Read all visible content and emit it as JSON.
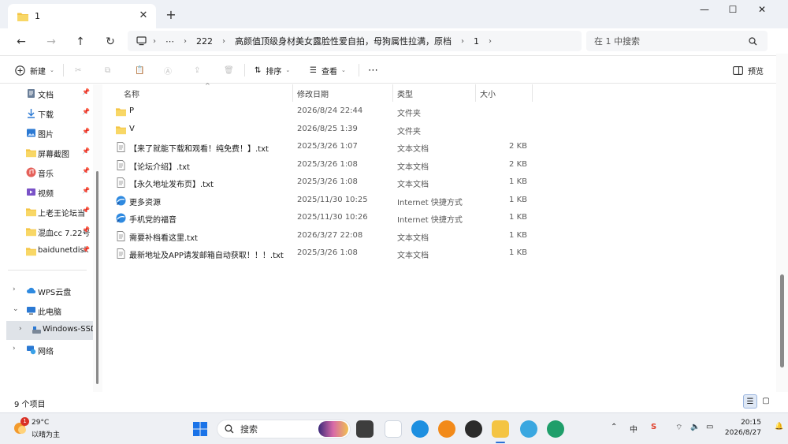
{
  "tab": {
    "title": "1",
    "close": "✕",
    "new": "+"
  },
  "window_controls": {
    "minimize": "—",
    "maximize": "☐",
    "close": "✕"
  },
  "address": {
    "more": "⋯",
    "crumbs": [
      "222",
      "高颜值顶级身材美女露脸性爱自拍，母狗属性拉满，原档",
      "1"
    ],
    "search_placeholder": "在 1 中搜索"
  },
  "commands": {
    "new": "新建",
    "sort": "排序",
    "view": "查看",
    "more": "⋯",
    "preview": "预览"
  },
  "sidebar": {
    "quick": [
      {
        "label": "文档",
        "icon": "document-icon"
      },
      {
        "label": "下载",
        "icon": "download-icon"
      },
      {
        "label": "图片",
        "icon": "pictures-icon"
      },
      {
        "label": "屏幕截图",
        "icon": "folder-icon"
      },
      {
        "label": "音乐",
        "icon": "music-icon"
      },
      {
        "label": "视频",
        "icon": "video-icon"
      },
      {
        "label": "上老王论坛当",
        "icon": "folder-icon"
      },
      {
        "label": "混血cc 7.22号",
        "icon": "folder-icon"
      },
      {
        "label": "baidunetdisk",
        "icon": "folder-icon"
      }
    ],
    "tree": [
      {
        "label": "WPS云盘",
        "chev": "›"
      },
      {
        "label": "此电脑",
        "chev": "⌄"
      },
      {
        "label": "Windows-SSD",
        "chev": "›"
      },
      {
        "label": "网络",
        "chev": "›"
      }
    ]
  },
  "columns": {
    "name": "名称",
    "date": "修改日期",
    "type": "类型",
    "size": "大小"
  },
  "files": [
    {
      "name": "P",
      "date": "2026/8/24 22:44",
      "type": "文件夹",
      "size": "",
      "kind": "folder"
    },
    {
      "name": "V",
      "date": "2026/8/25 1:39",
      "type": "文件夹",
      "size": "",
      "kind": "folder"
    },
    {
      "name": "【来了就能下载和观看！纯免费！】.txt",
      "date": "2025/3/26 1:07",
      "type": "文本文档",
      "size": "2 KB",
      "kind": "text"
    },
    {
      "name": "【论坛介绍】.txt",
      "date": "2025/3/26 1:08",
      "type": "文本文档",
      "size": "2 KB",
      "kind": "text"
    },
    {
      "name": "【永久地址发布页】.txt",
      "date": "2025/3/26 1:08",
      "type": "文本文档",
      "size": "1 KB",
      "kind": "text"
    },
    {
      "name": "更多资源",
      "date": "2025/11/30 10:25",
      "type": "Internet 快捷方式",
      "size": "1 KB",
      "kind": "url"
    },
    {
      "name": "手机党的福音",
      "date": "2025/11/30 10:26",
      "type": "Internet 快捷方式",
      "size": "1 KB",
      "kind": "url"
    },
    {
      "name": "需要补档看这里.txt",
      "date": "2026/3/27 22:08",
      "type": "文本文档",
      "size": "1 KB",
      "kind": "text"
    },
    {
      "name": "最新地址及APP请发邮箱自动获取！！！.txt",
      "date": "2025/3/26 1:08",
      "type": "文本文档",
      "size": "1 KB",
      "kind": "text"
    }
  ],
  "status": {
    "count": "9 个项目"
  },
  "taskbar": {
    "weather_badge": "1",
    "temp": "29°C",
    "weather": "以晴为主",
    "search": "搜索",
    "time": "20:15",
    "date": "2026/8/27",
    "ime": "中"
  }
}
